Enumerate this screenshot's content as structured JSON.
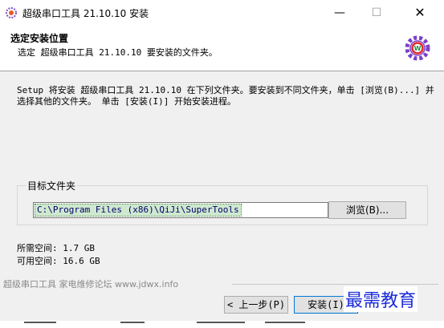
{
  "window": {
    "title": "超级串口工具 21.10.10 安装",
    "minimize": "—",
    "maximize": "☐",
    "close": "✕"
  },
  "header": {
    "title": "选定安装位置",
    "subtitle": "选定 超级串口工具 21.10.10 要安装的文件夹。"
  },
  "description": "Setup 将安装 超级串口工具 21.10.10 在下列文件夹。要安装到不同文件夹，单击 [浏览(B)...] 并选择其他的文件夹。 单击 [安装(I)] 开始安装进程。",
  "target_group": {
    "label": "目标文件夹",
    "path_value": "C:\\Program Files (x86)\\QiJi\\SuperTools",
    "browse_label": "浏览(B)..."
  },
  "space": {
    "required": "所需空间: 1.7 GB",
    "available": "可用空间: 16.6 GB"
  },
  "branding": "超级串口工具 家电维修论坛 www.jdwx.info",
  "buttons": {
    "back": "< 上一步(P)",
    "install": "安装(I)"
  },
  "watermark": "最需教育",
  "colors": {
    "accent": "#0078d7",
    "selection": "#cfe8cf",
    "watermark": "#1a2bd8"
  },
  "icons": {
    "app": "gear-app-icon",
    "header": "gear-badge-icon"
  }
}
